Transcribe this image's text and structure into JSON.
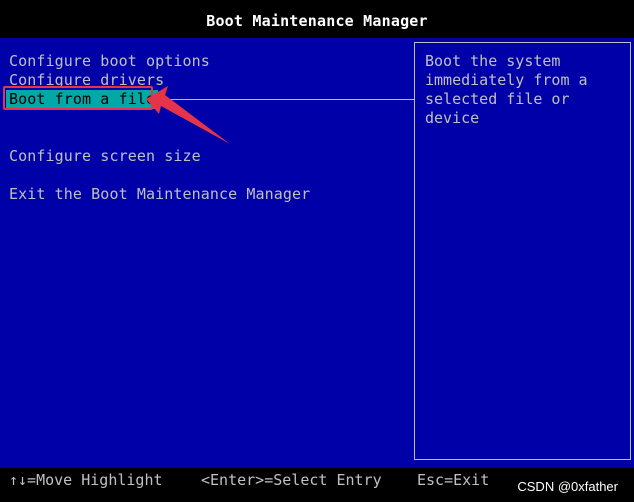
{
  "header": {
    "title": "Boot Maintenance Manager"
  },
  "menu": {
    "items": [
      {
        "label": "Configure boot options"
      },
      {
        "label": "Configure drivers"
      },
      {
        "label": "Boot from a file",
        "selected": true
      },
      {
        "label": "Configure screen size"
      },
      {
        "label": "Exit the Boot Maintenance Manager"
      }
    ]
  },
  "help": {
    "text": "Boot the system\nimmediately from a\nselected file or device"
  },
  "footer": {
    "move_hint": "↑↓=Move Highlight",
    "select_hint": "<Enter>=Select Entry",
    "exit_hint": "Esc=Exit"
  },
  "watermark": {
    "text": "CSDN @0xfather"
  },
  "colors": {
    "background": "#0000a8",
    "text": "#c0c0c0",
    "highlight": "#00a8a8",
    "annotation": "#e5344a",
    "bar": "#000000"
  }
}
